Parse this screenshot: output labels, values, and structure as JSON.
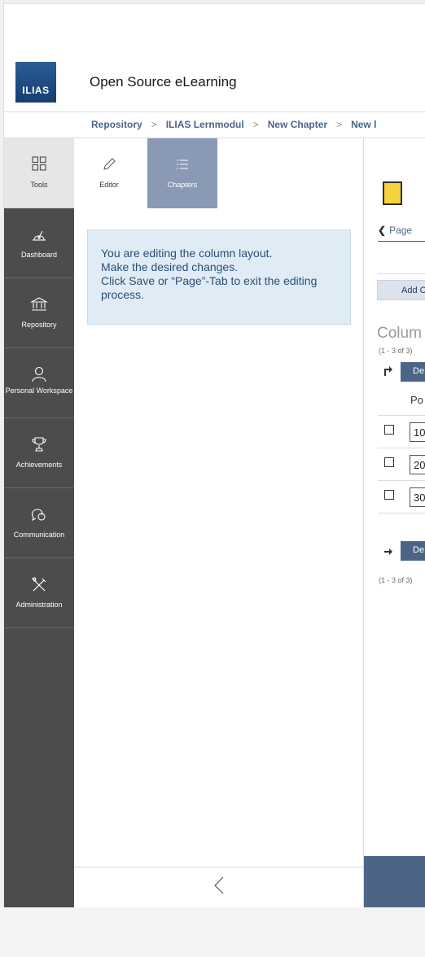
{
  "header": {
    "logo_text": "ILIAS",
    "site_title": "Open Source eLearning"
  },
  "breadcrumb": [
    "Repository",
    "ILIAS Lernmodul",
    "New Chapter",
    "New l"
  ],
  "mainbar": {
    "items": [
      {
        "label": "Tools",
        "icon": "grid-icon"
      },
      {
        "label": "Dashboard",
        "icon": "dashboard-icon"
      },
      {
        "label": "Repository",
        "icon": "bank-icon"
      },
      {
        "label": "Personal Workspace",
        "icon": "user-icon"
      },
      {
        "label": "Achievements",
        "icon": "trophy-icon"
      },
      {
        "label": "Communication",
        "icon": "chat-icon"
      },
      {
        "label": "Administration",
        "icon": "tools-icon"
      }
    ]
  },
  "slate": {
    "tabs": [
      {
        "label": "Editor",
        "icon": "pencil-icon"
      },
      {
        "label": "Chapters",
        "icon": "list-icon"
      }
    ],
    "info_lines": [
      "You are editing the column layout.",
      "Make the desired changes.",
      "Click Save or “Page”-Tab to exit the editing",
      "process."
    ]
  },
  "content": {
    "page_link": "Page",
    "add_button": "Add C",
    "table_title": "Colum",
    "range_top": "(1 - 3 of 3)",
    "range_bottom": "(1 - 3 of 3)",
    "action_button_top": "De",
    "action_button_bottom": "De",
    "column_header": "Po",
    "rows": [
      {
        "position": "10"
      },
      {
        "position": "20"
      },
      {
        "position": "30"
      }
    ]
  },
  "colors": {
    "mainbar_bg": "#4c4c4c",
    "accent": "#4c6586",
    "info_bg": "#dfecf6",
    "chapters_tab": "#8a9ab4",
    "page_icon": "#f5d33f"
  }
}
